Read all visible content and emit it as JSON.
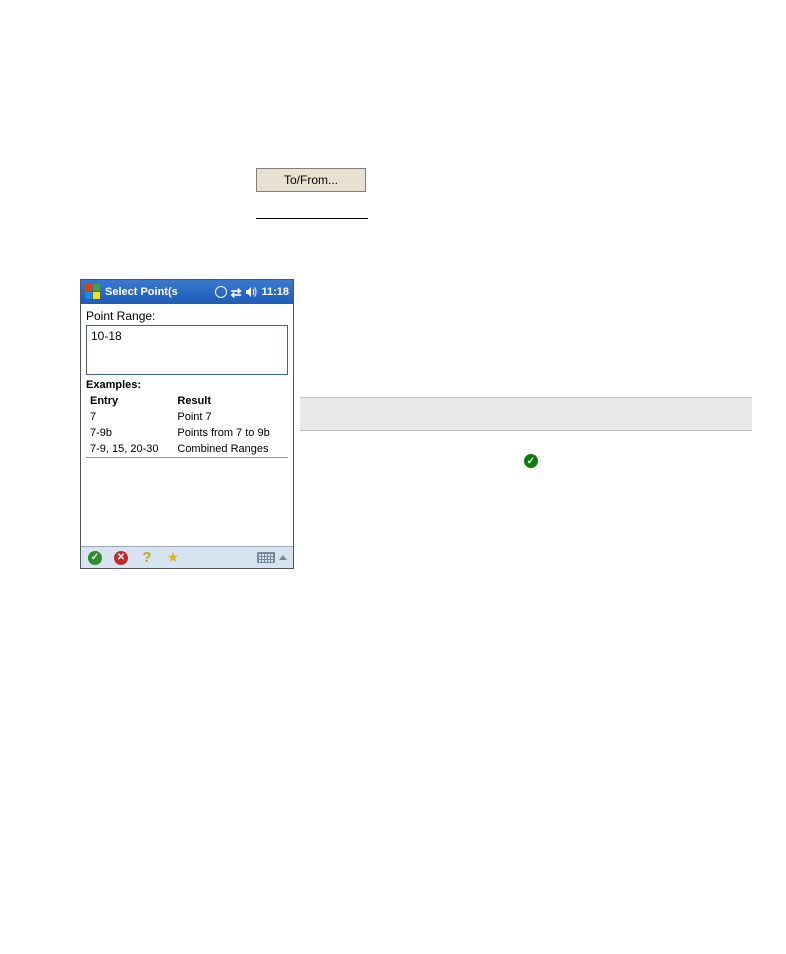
{
  "tofrom_button_label": "To/From...",
  "device": {
    "titlebar": {
      "title": "Select Point(s",
      "time": "11:18"
    },
    "label": "Point Range:",
    "input_value": "10-18",
    "examples": {
      "legend": "Examples:",
      "headers": {
        "entry": "Entry",
        "result": "Result"
      },
      "rows": [
        {
          "entry": "7",
          "result": "Point 7"
        },
        {
          "entry": "7-9b",
          "result": "Points from 7 to 9b"
        },
        {
          "entry": "7-9, 15, 20-30",
          "result": "Combined Ranges"
        }
      ]
    }
  }
}
